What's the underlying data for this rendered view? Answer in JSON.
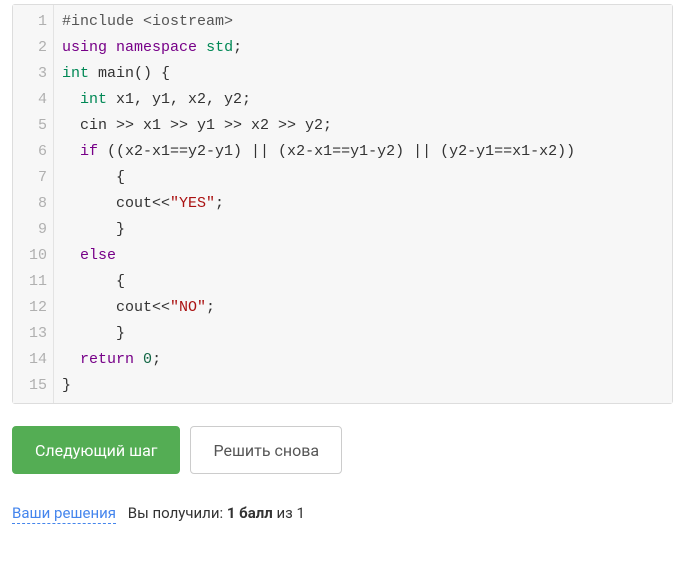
{
  "code": {
    "lines": [
      {
        "n": 1,
        "html": "<span class='cm-meta'>#include &lt;iostream&gt;</span>"
      },
      {
        "n": 2,
        "html": "<span class='cm-keyword'>using</span> <span class='cm-keyword'>namespace</span> <span class='cm-std'>std</span>;"
      },
      {
        "n": 3,
        "html": "<span class='cm-type'>int</span> <span class='cm-def' style='color:#333'>main</span>() {"
      },
      {
        "n": 4,
        "html": "  <span class='cm-type'>int</span> x1, y1, x2, y2;"
      },
      {
        "n": 5,
        "html": "  cin &gt;&gt; x1 &gt;&gt; y1 &gt;&gt; x2 &gt;&gt; y2;"
      },
      {
        "n": 6,
        "html": "  <span class='cm-keyword'>if</span> ((x2-x1==y2-y1) || (x2-x1==y1-y2) || (y2-y1==x1-x2))"
      },
      {
        "n": 7,
        "html": "      {"
      },
      {
        "n": 8,
        "html": "      cout&lt;&lt;<span class='cm-string'>\"YES\"</span>;"
      },
      {
        "n": 9,
        "html": "      }"
      },
      {
        "n": 10,
        "html": "  <span class='cm-keyword'>else</span>"
      },
      {
        "n": 11,
        "html": "      {"
      },
      {
        "n": 12,
        "html": "      cout&lt;&lt;<span class='cm-string'>\"NO\"</span>;"
      },
      {
        "n": 13,
        "html": "      }"
      },
      {
        "n": 14,
        "html": "  <span class='cm-keyword'>return</span> <span class='cm-number'>0</span>;"
      },
      {
        "n": 15,
        "html": "}"
      }
    ]
  },
  "buttons": {
    "next_label": "Следующий шаг",
    "retry_label": "Решить снова"
  },
  "footer": {
    "solutions_link": "Ваши решения",
    "score_prefix": "Вы получили: ",
    "score_bold": "1 балл",
    "score_suffix": " из 1"
  }
}
